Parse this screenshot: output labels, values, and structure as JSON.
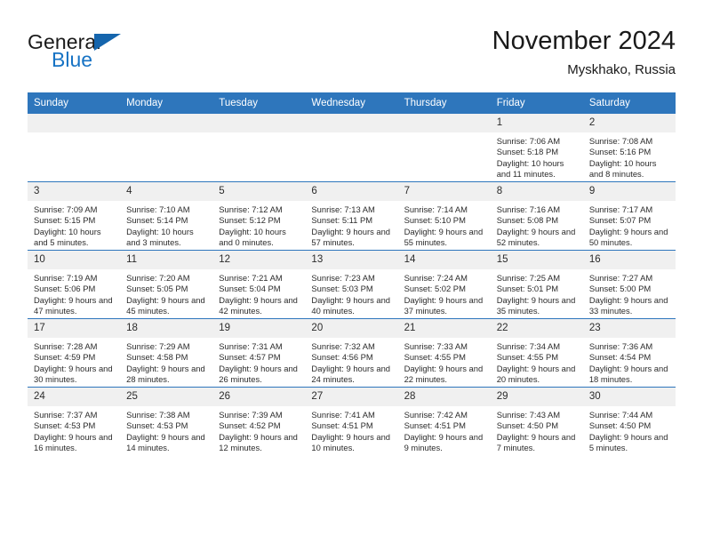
{
  "brand": {
    "name_part1": "General",
    "name_part2": "Blue",
    "logo_icon": "triangle-flag-icon"
  },
  "header": {
    "title": "November 2024",
    "subtitle": "Myskhako, Russia"
  },
  "colors": {
    "header_blue": "#2e76bc",
    "brand_blue": "#1773c4",
    "daynum_band": "#f0f0f0",
    "text": "#2b2b2b"
  },
  "calendar": {
    "weekday_headers": [
      "Sunday",
      "Monday",
      "Tuesday",
      "Wednesday",
      "Thursday",
      "Friday",
      "Saturday"
    ],
    "weeks": [
      [
        {
          "day": "",
          "blank": true
        },
        {
          "day": "",
          "blank": true
        },
        {
          "day": "",
          "blank": true
        },
        {
          "day": "",
          "blank": true
        },
        {
          "day": "",
          "blank": true
        },
        {
          "day": "1",
          "sunrise": "Sunrise: 7:06 AM",
          "sunset": "Sunset: 5:18 PM",
          "daylight": "Daylight: 10 hours and 11 minutes."
        },
        {
          "day": "2",
          "sunrise": "Sunrise: 7:08 AM",
          "sunset": "Sunset: 5:16 PM",
          "daylight": "Daylight: 10 hours and 8 minutes."
        }
      ],
      [
        {
          "day": "3",
          "sunrise": "Sunrise: 7:09 AM",
          "sunset": "Sunset: 5:15 PM",
          "daylight": "Daylight: 10 hours and 5 minutes."
        },
        {
          "day": "4",
          "sunrise": "Sunrise: 7:10 AM",
          "sunset": "Sunset: 5:14 PM",
          "daylight": "Daylight: 10 hours and 3 minutes."
        },
        {
          "day": "5",
          "sunrise": "Sunrise: 7:12 AM",
          "sunset": "Sunset: 5:12 PM",
          "daylight": "Daylight: 10 hours and 0 minutes."
        },
        {
          "day": "6",
          "sunrise": "Sunrise: 7:13 AM",
          "sunset": "Sunset: 5:11 PM",
          "daylight": "Daylight: 9 hours and 57 minutes."
        },
        {
          "day": "7",
          "sunrise": "Sunrise: 7:14 AM",
          "sunset": "Sunset: 5:10 PM",
          "daylight": "Daylight: 9 hours and 55 minutes."
        },
        {
          "day": "8",
          "sunrise": "Sunrise: 7:16 AM",
          "sunset": "Sunset: 5:08 PM",
          "daylight": "Daylight: 9 hours and 52 minutes."
        },
        {
          "day": "9",
          "sunrise": "Sunrise: 7:17 AM",
          "sunset": "Sunset: 5:07 PM",
          "daylight": "Daylight: 9 hours and 50 minutes."
        }
      ],
      [
        {
          "day": "10",
          "sunrise": "Sunrise: 7:19 AM",
          "sunset": "Sunset: 5:06 PM",
          "daylight": "Daylight: 9 hours and 47 minutes."
        },
        {
          "day": "11",
          "sunrise": "Sunrise: 7:20 AM",
          "sunset": "Sunset: 5:05 PM",
          "daylight": "Daylight: 9 hours and 45 minutes."
        },
        {
          "day": "12",
          "sunrise": "Sunrise: 7:21 AM",
          "sunset": "Sunset: 5:04 PM",
          "daylight": "Daylight: 9 hours and 42 minutes."
        },
        {
          "day": "13",
          "sunrise": "Sunrise: 7:23 AM",
          "sunset": "Sunset: 5:03 PM",
          "daylight": "Daylight: 9 hours and 40 minutes."
        },
        {
          "day": "14",
          "sunrise": "Sunrise: 7:24 AM",
          "sunset": "Sunset: 5:02 PM",
          "daylight": "Daylight: 9 hours and 37 minutes."
        },
        {
          "day": "15",
          "sunrise": "Sunrise: 7:25 AM",
          "sunset": "Sunset: 5:01 PM",
          "daylight": "Daylight: 9 hours and 35 minutes."
        },
        {
          "day": "16",
          "sunrise": "Sunrise: 7:27 AM",
          "sunset": "Sunset: 5:00 PM",
          "daylight": "Daylight: 9 hours and 33 minutes."
        }
      ],
      [
        {
          "day": "17",
          "sunrise": "Sunrise: 7:28 AM",
          "sunset": "Sunset: 4:59 PM",
          "daylight": "Daylight: 9 hours and 30 minutes."
        },
        {
          "day": "18",
          "sunrise": "Sunrise: 7:29 AM",
          "sunset": "Sunset: 4:58 PM",
          "daylight": "Daylight: 9 hours and 28 minutes."
        },
        {
          "day": "19",
          "sunrise": "Sunrise: 7:31 AM",
          "sunset": "Sunset: 4:57 PM",
          "daylight": "Daylight: 9 hours and 26 minutes."
        },
        {
          "day": "20",
          "sunrise": "Sunrise: 7:32 AM",
          "sunset": "Sunset: 4:56 PM",
          "daylight": "Daylight: 9 hours and 24 minutes."
        },
        {
          "day": "21",
          "sunrise": "Sunrise: 7:33 AM",
          "sunset": "Sunset: 4:55 PM",
          "daylight": "Daylight: 9 hours and 22 minutes."
        },
        {
          "day": "22",
          "sunrise": "Sunrise: 7:34 AM",
          "sunset": "Sunset: 4:55 PM",
          "daylight": "Daylight: 9 hours and 20 minutes."
        },
        {
          "day": "23",
          "sunrise": "Sunrise: 7:36 AM",
          "sunset": "Sunset: 4:54 PM",
          "daylight": "Daylight: 9 hours and 18 minutes."
        }
      ],
      [
        {
          "day": "24",
          "sunrise": "Sunrise: 7:37 AM",
          "sunset": "Sunset: 4:53 PM",
          "daylight": "Daylight: 9 hours and 16 minutes."
        },
        {
          "day": "25",
          "sunrise": "Sunrise: 7:38 AM",
          "sunset": "Sunset: 4:53 PM",
          "daylight": "Daylight: 9 hours and 14 minutes."
        },
        {
          "day": "26",
          "sunrise": "Sunrise: 7:39 AM",
          "sunset": "Sunset: 4:52 PM",
          "daylight": "Daylight: 9 hours and 12 minutes."
        },
        {
          "day": "27",
          "sunrise": "Sunrise: 7:41 AM",
          "sunset": "Sunset: 4:51 PM",
          "daylight": "Daylight: 9 hours and 10 minutes."
        },
        {
          "day": "28",
          "sunrise": "Sunrise: 7:42 AM",
          "sunset": "Sunset: 4:51 PM",
          "daylight": "Daylight: 9 hours and 9 minutes."
        },
        {
          "day": "29",
          "sunrise": "Sunrise: 7:43 AM",
          "sunset": "Sunset: 4:50 PM",
          "daylight": "Daylight: 9 hours and 7 minutes."
        },
        {
          "day": "30",
          "sunrise": "Sunrise: 7:44 AM",
          "sunset": "Sunset: 4:50 PM",
          "daylight": "Daylight: 9 hours and 5 minutes."
        }
      ]
    ]
  }
}
